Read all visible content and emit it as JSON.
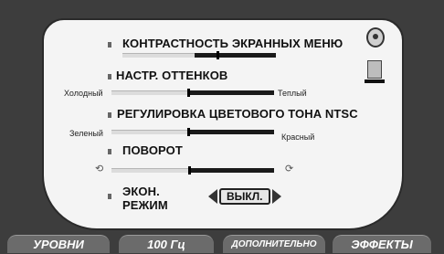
{
  "menu": {
    "rows": [
      {
        "label": "КОНТРАСТНОСТЬ ЭКРАННЫХ МЕНЮ"
      },
      {
        "label": "НАСТР. ОТТЕНКОВ",
        "left": "Холодный",
        "right": "Теплый"
      },
      {
        "label": "РЕГУЛИРОВКА ЦВЕТОВОГО ТОНА NTSC",
        "left": "Зеленый",
        "right": "Красный"
      },
      {
        "label": "ПОВОРОТ"
      },
      {
        "label_line1": "ЭКОН.",
        "label_line2": "РЕЖИМ",
        "value": "ВЫКЛ."
      }
    ]
  },
  "levels": {
    "osd_contrast": 0.62,
    "tint": 0.47,
    "ntsc_hue": 0.47,
    "rotation": 0.48
  },
  "tabs": [
    {
      "label": "УРОВНИ"
    },
    {
      "label": "100 Гц"
    },
    {
      "label": "ДОПОЛНИТЕЛЬНО"
    },
    {
      "label": "ЭФФЕКТЫ"
    }
  ],
  "colors": {
    "frame": "#3d3d3d",
    "panel": "#f4f4f4",
    "tab": "#6b6b6b"
  },
  "icons": [
    "menu-disc-icon",
    "monitor-icon",
    "rotate-left-icon",
    "rotate-right-icon"
  ]
}
